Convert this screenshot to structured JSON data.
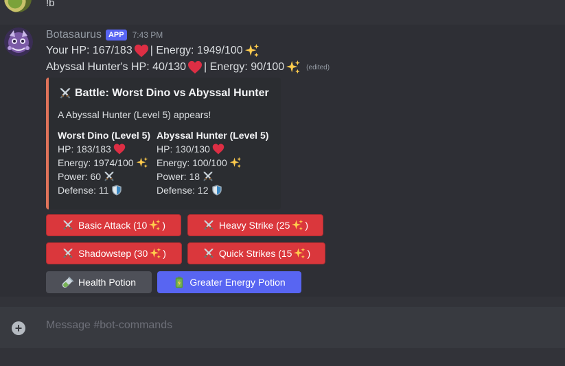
{
  "previous_message": {
    "text": "!b"
  },
  "message": {
    "author": "Botasaurus",
    "badge": "APP",
    "timestamp": "7:43 PM",
    "line1": {
      "hp": "Your HP: 167/183",
      "energy": "| Energy: 1949/100"
    },
    "line2": {
      "hp": "Abyssal Hunter's HP: 40/130",
      "energy": "| Energy: 90/100",
      "edited": "(edited)"
    }
  },
  "embed": {
    "title": "Battle: Worst Dino vs Abyssal Hunter",
    "description": "A Abyssal Hunter (Level 5) appears!",
    "fields": [
      {
        "name": "Worst Dino (Level 5)",
        "hp": "HP: 183/183",
        "energy": "Energy: 1974/100",
        "power": "Power: 60",
        "defense": "Defense: 11"
      },
      {
        "name": "Abyssal Hunter (Level 5)",
        "hp": "HP: 130/130",
        "energy": "Energy: 100/100",
        "power": "Power: 18",
        "defense": "Defense: 12"
      }
    ],
    "accent_color": "#e0735a"
  },
  "buttons": {
    "basic_attack": "Basic Attack (10",
    "heavy_strike": "Heavy Strike (25",
    "shadowstep": "Shadowstep (30",
    "quick_strikes": "Quick Strikes (15",
    "close_paren": ")",
    "health_potion": "Health Potion",
    "greater_energy_potion": "Greater Energy Potion"
  },
  "composer": {
    "placeholder": "Message #bot-commands"
  },
  "colors": {
    "danger": "#da373c",
    "secondary": "#4e5058",
    "brand": "#5865f2"
  },
  "icons": [
    "crossed-swords-icon",
    "heart-icon",
    "sparkles-icon",
    "shield-icon",
    "test-tube-icon",
    "battery-icon",
    "plus-icon"
  ]
}
